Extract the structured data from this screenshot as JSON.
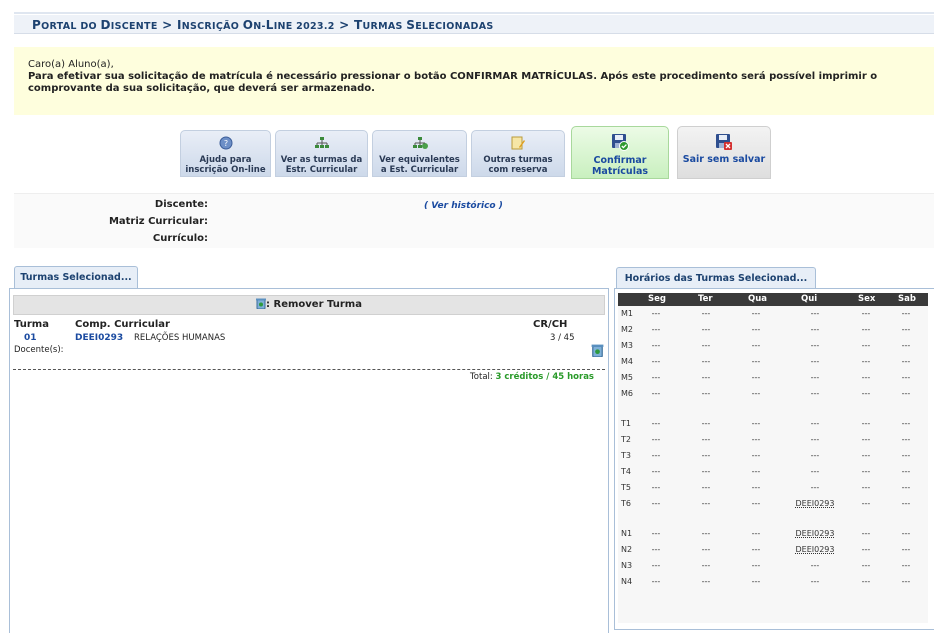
{
  "breadcrumb": {
    "portal_cap": "P",
    "portal_rest": "ORTAL DO ",
    "disc_cap": "D",
    "disc_rest": "ISCENTE",
    "sep1": " > ",
    "ins_cap": "I",
    "ins_rest": "NSCRIÇÃO ",
    "on_cap": "O",
    "on_rest": "N-",
    "line_cap": "L",
    "line_rest": "INE 2023.2",
    "sep2": " > ",
    "tur_cap": "T",
    "tur_rest": "URMAS ",
    "sel_cap": "S",
    "sel_rest": "ELECIONADAS"
  },
  "notice": {
    "greeting": "Caro(a) Aluno(a),",
    "message": "Para efetivar sua solicitação de matrícula é necessário pressionar o botão CONFIRMAR MATRÍCULAS. Após este procedimento será possível imprimir o comprovante da sua solicitação, que deverá ser armazenado."
  },
  "toolbar": {
    "help_l1": "Ajuda para",
    "help_l2": "inscrição On-line",
    "turmas_l1": "Ver as turmas da",
    "turmas_l2": "Estr. Curricular",
    "equiv_l1": "Ver equivalentes",
    "equiv_l2": "a Est. Curricular",
    "outras_l1": "Outras turmas",
    "outras_l2": "com reserva",
    "confirm_l1": "Confirmar",
    "confirm_l2": "Matrículas",
    "exit": "Sair sem salvar"
  },
  "student": {
    "discente_label": "Discente:",
    "matriz_label": "Matriz Curricular:",
    "curriculo_label": "Currículo:",
    "history_link": "( Ver histórico )"
  },
  "selected": {
    "tab": "Turmas Selecionad...",
    "remove_label": ": Remover Turma",
    "col_turma": "Turma",
    "col_comp": "Comp. Curricular",
    "col_crch": "CR/CH",
    "row": {
      "turma": "01",
      "code": "DEEI0293",
      "name": "RELAÇÕES HUMANAS",
      "crch": "3 / 45",
      "docente_label": "Docente(s):"
    },
    "total_label": "Total: ",
    "total_value": "3 créditos / 45 horas"
  },
  "schedule": {
    "tab": "Horários das Turmas Selecionad...",
    "days": [
      "Seg",
      "Ter",
      "Qua",
      "Qui",
      "Sex",
      "Sab"
    ],
    "rows": [
      {
        "slot": "M1",
        "cells": [
          "---",
          "---",
          "---",
          "---",
          "---",
          "---"
        ]
      },
      {
        "slot": "M2",
        "cells": [
          "---",
          "---",
          "---",
          "---",
          "---",
          "---"
        ]
      },
      {
        "slot": "M3",
        "cells": [
          "---",
          "---",
          "---",
          "---",
          "---",
          "---"
        ]
      },
      {
        "slot": "M4",
        "cells": [
          "---",
          "---",
          "---",
          "---",
          "---",
          "---"
        ]
      },
      {
        "slot": "M5",
        "cells": [
          "---",
          "---",
          "---",
          "---",
          "---",
          "---"
        ]
      },
      {
        "slot": "M6",
        "cells": [
          "---",
          "---",
          "---",
          "---",
          "---",
          "---"
        ]
      },
      {
        "slot": "T1",
        "cells": [
          "---",
          "---",
          "---",
          "---",
          "---",
          "---"
        ]
      },
      {
        "slot": "T2",
        "cells": [
          "---",
          "---",
          "---",
          "---",
          "---",
          "---"
        ]
      },
      {
        "slot": "T3",
        "cells": [
          "---",
          "---",
          "---",
          "---",
          "---",
          "---"
        ]
      },
      {
        "slot": "T4",
        "cells": [
          "---",
          "---",
          "---",
          "---",
          "---",
          "---"
        ]
      },
      {
        "slot": "T5",
        "cells": [
          "---",
          "---",
          "---",
          "---",
          "---",
          "---"
        ]
      },
      {
        "slot": "T6",
        "cells": [
          "---",
          "---",
          "---",
          "DEEI0293",
          "---",
          "---"
        ]
      },
      {
        "slot": "N1",
        "cells": [
          "---",
          "---",
          "---",
          "DEEI0293",
          "---",
          "---"
        ]
      },
      {
        "slot": "N2",
        "cells": [
          "---",
          "---",
          "---",
          "DEEI0293",
          "---",
          "---"
        ]
      },
      {
        "slot": "N3",
        "cells": [
          "---",
          "---",
          "---",
          "---",
          "---",
          "---"
        ]
      },
      {
        "slot": "N4",
        "cells": [
          "---",
          "---",
          "---",
          "---",
          "---",
          "---"
        ]
      }
    ]
  },
  "colors": {
    "header_text": "#1d4270",
    "link": "#1a4aa0",
    "total": "#2a9a2a",
    "notice_bg": "#fefedd"
  }
}
